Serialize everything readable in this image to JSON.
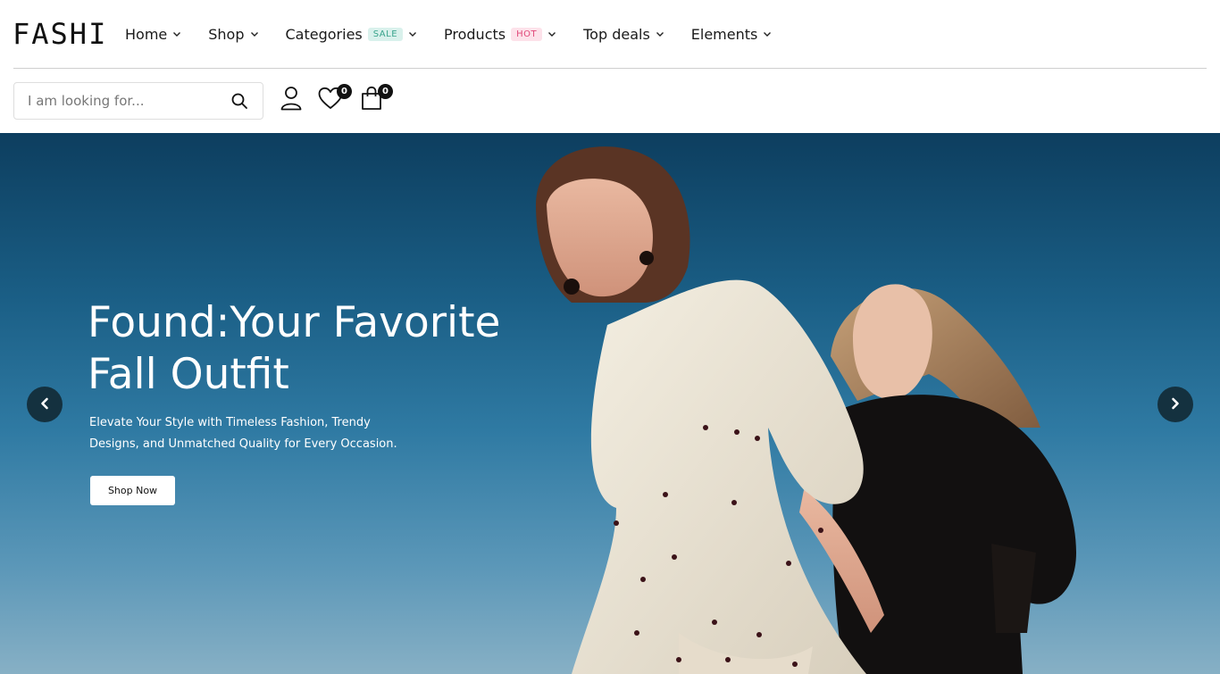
{
  "brand": {
    "logo": "FASHI"
  },
  "nav": {
    "items": [
      {
        "label": "Home"
      },
      {
        "label": "Shop"
      },
      {
        "label": "Categories",
        "badge": "SALE"
      },
      {
        "label": "Products",
        "badge": "HOT"
      },
      {
        "label": "Top deals"
      },
      {
        "label": "Elements"
      }
    ]
  },
  "search": {
    "placeholder": "I am looking for..."
  },
  "actions": {
    "wishlist_count": "0",
    "cart_count": "0"
  },
  "hero": {
    "title": "Found:Your Favorite Fall Outfit",
    "subtitle": "Elevate Your Style with Timeless Fashion, Trendy Designs, and Unmatched Quality for Every Occasion.",
    "button_label": "Shop Now"
  },
  "colors": {
    "sale_badge": "#3aa48c",
    "hot_badge": "#e0497a",
    "sky_top": "#0d3e5f",
    "arrow_bg": "#14313f"
  }
}
